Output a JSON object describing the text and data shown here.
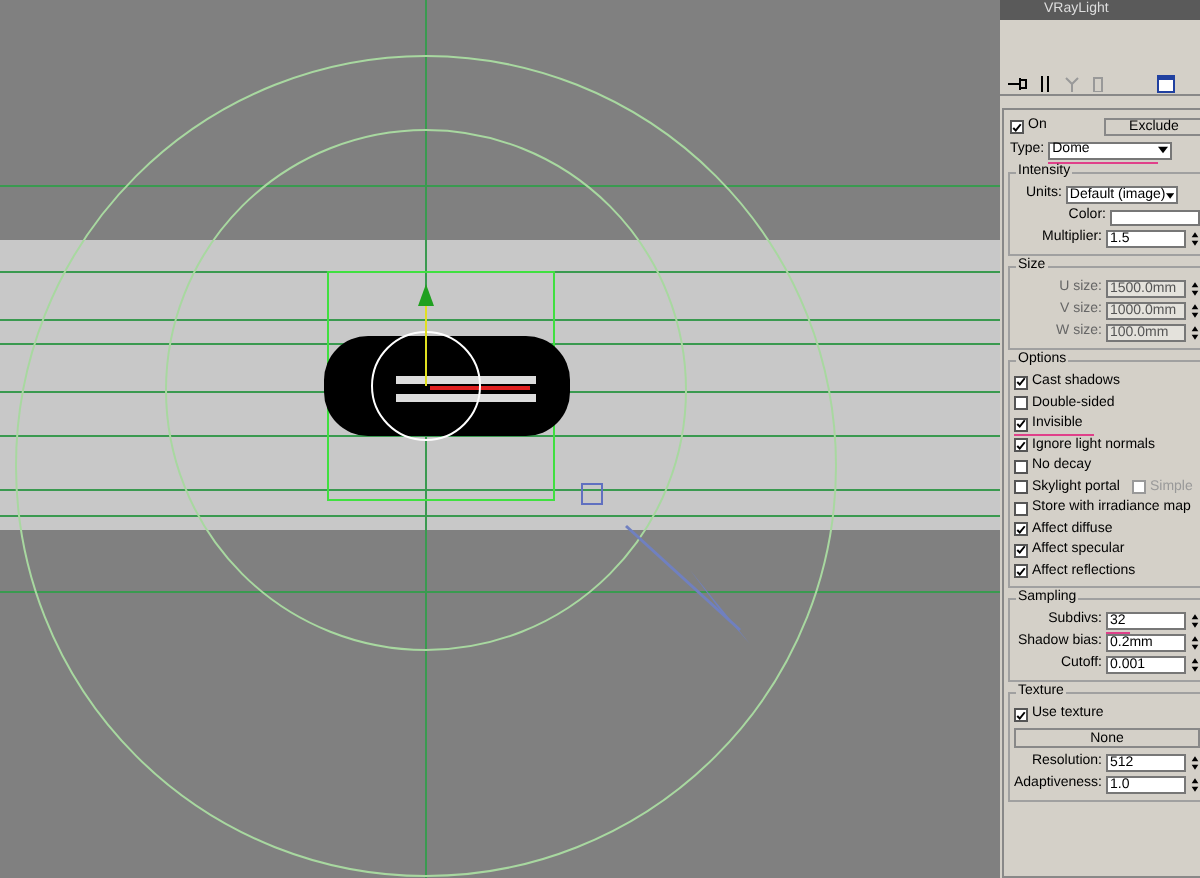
{
  "panel": {
    "title": "VRayLight",
    "general": {
      "on": {
        "label": "On",
        "checked": true
      },
      "exclude_button": "Exclude",
      "type": {
        "label": "Type:",
        "value": "Dome",
        "underlined": true
      }
    },
    "intensity": {
      "title": "Intensity",
      "units_label": "Units:",
      "units_value": "Default (image)",
      "color_label": "Color:",
      "multiplier_label": "Multiplier:",
      "multiplier_value": "1.5"
    },
    "size": {
      "title": "Size",
      "fields": [
        {
          "label": "U size:",
          "value": "1500.0mm",
          "disabled": true
        },
        {
          "label": "V size:",
          "value": "1000.0mm",
          "disabled": true
        },
        {
          "label": "W size:",
          "value": "100.0mm",
          "disabled": true
        }
      ]
    },
    "options": {
      "title": "Options",
      "items": [
        {
          "label": "Cast shadows",
          "checked": true
        },
        {
          "label": "Double-sided",
          "checked": false
        },
        {
          "label": "Invisible",
          "checked": true,
          "underlined": true
        },
        {
          "label": "Ignore light normals",
          "checked": true
        },
        {
          "label": "No decay",
          "checked": false
        },
        {
          "label": "Skylight portal",
          "checked": false,
          "extra": {
            "label": "Simple",
            "checked": false,
            "disabled": true
          }
        },
        {
          "label": "Store with irradiance map",
          "checked": false
        },
        {
          "label": "Affect diffuse",
          "checked": true
        },
        {
          "label": "Affect specular",
          "checked": true
        },
        {
          "label": "Affect reflections",
          "checked": true
        }
      ]
    },
    "sampling": {
      "title": "Sampling",
      "fields": [
        {
          "label": "Subdivs:",
          "value": "32",
          "underlined": true
        },
        {
          "label": "Shadow bias:",
          "value": "0.2mm"
        },
        {
          "label": "Cutoff:",
          "value": "0.001"
        }
      ]
    },
    "texture": {
      "title": "Texture",
      "use_texture": {
        "label": "Use texture",
        "checked": true
      },
      "map_button": "None",
      "fields": [
        {
          "label": "Resolution:",
          "value": "512"
        },
        {
          "label": "Adaptiveness:",
          "value": "1.0"
        }
      ]
    }
  }
}
